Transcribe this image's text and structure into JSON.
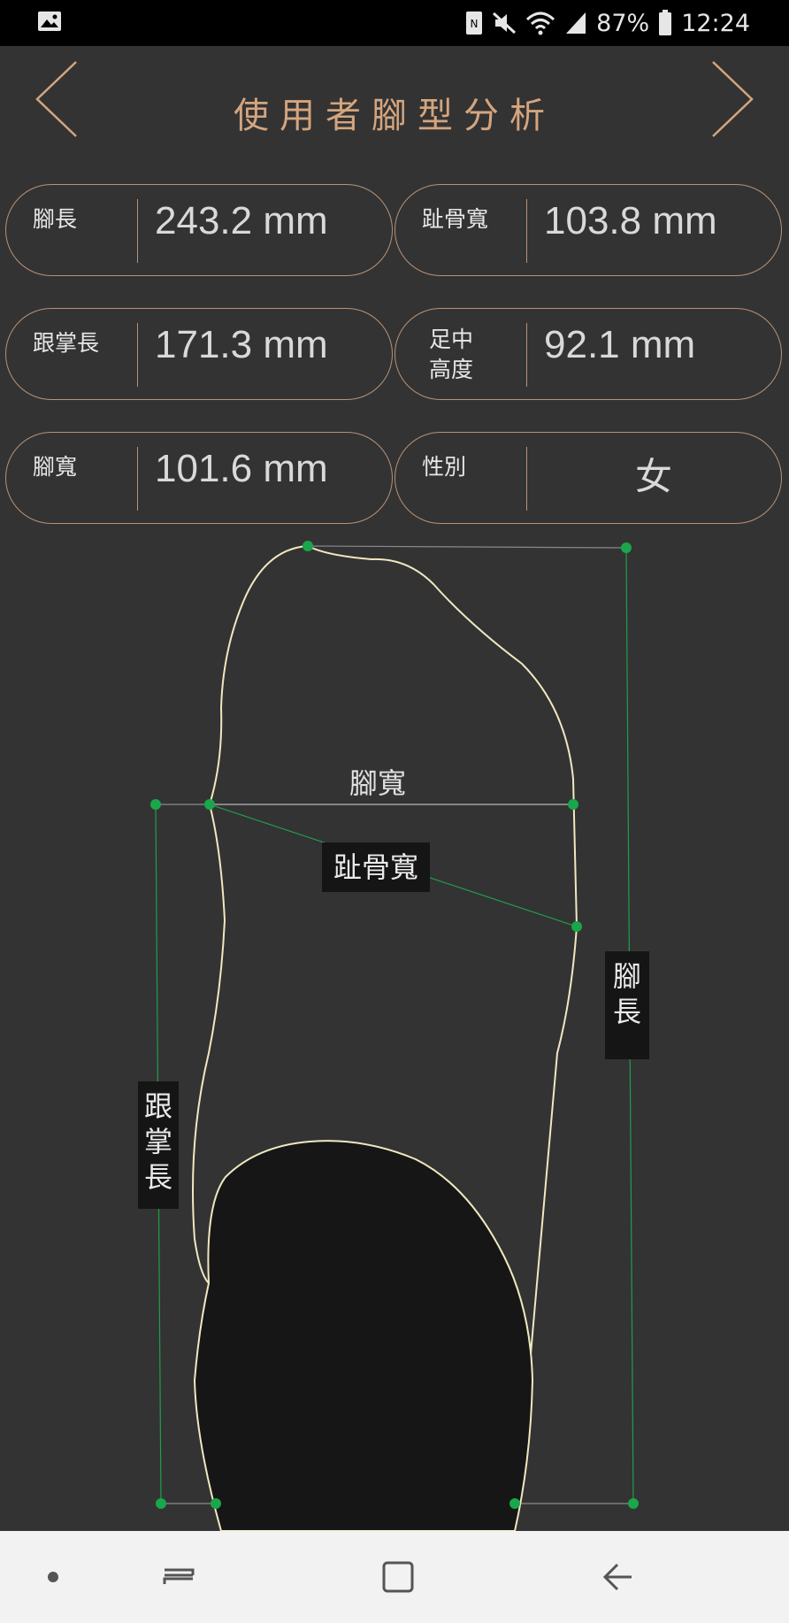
{
  "status_bar": {
    "battery": "87%",
    "time": "12:24",
    "icons": [
      "gallery-icon",
      "nfc-icon",
      "mute-icon",
      "wifi-icon",
      "signal-icon",
      "battery-icon"
    ]
  },
  "header": {
    "title": "使用者腳型分析",
    "prev_icon": "chevron-left-icon",
    "next_icon": "chevron-right-icon"
  },
  "metrics": {
    "foot_length": {
      "label": "腳長",
      "value": "243.2 mm"
    },
    "toe_width": {
      "label": "趾骨寬",
      "value": "103.8 mm"
    },
    "heel_palm": {
      "label": "跟掌長",
      "value": "171.3 mm"
    },
    "arch_height": {
      "label": "足中\n高度",
      "value": "92.1 mm"
    },
    "foot_width": {
      "label": "腳寬",
      "value": "101.6 mm"
    },
    "gender": {
      "label": "性別",
      "value": "女"
    }
  },
  "diagram": {
    "width_label": "腳寬",
    "toe_width_label": "趾骨寬",
    "length_label": "腳\n長",
    "heel_palm_label": "跟\n掌\n長"
  },
  "colors": {
    "accent": "#d4a57e",
    "border": "#b79277",
    "background": "#333333",
    "marker": "#1aa64a",
    "outline": "#f0e8c0"
  },
  "bottom_nav": {
    "icons": [
      "dot-icon",
      "recent-apps-icon",
      "home-icon",
      "back-icon"
    ]
  }
}
